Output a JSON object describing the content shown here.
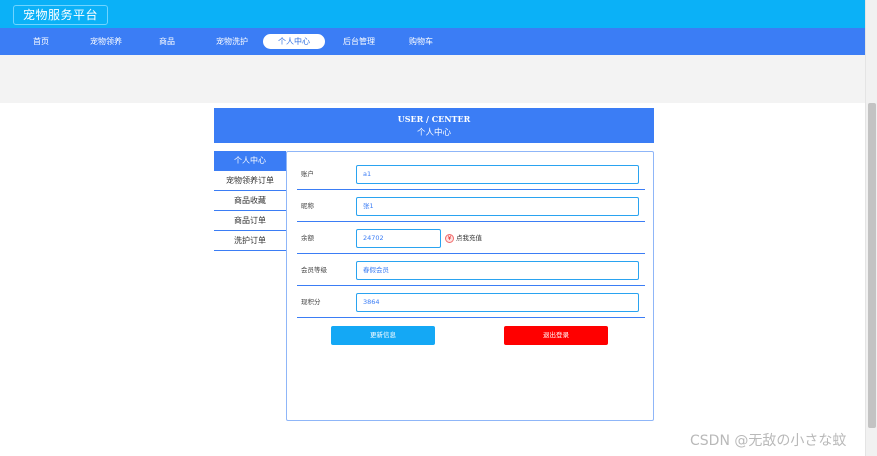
{
  "brand": "宠物服务平台",
  "nav": {
    "items": [
      "首页",
      "宠物领养",
      "商品",
      "宠物洗护",
      "个人中心",
      "后台管理",
      "购物车"
    ],
    "active": "个人中心"
  },
  "center": {
    "title_en": "USER / CENTER",
    "title_cn": "个人中心"
  },
  "menu": {
    "items": [
      "个人中心",
      "宠物领养订单",
      "商品收藏",
      "商品订单",
      "洗护订单"
    ]
  },
  "form": {
    "account_label": "账户",
    "account_value": "a1",
    "nickname_label": "昵称",
    "nickname_value": "张1",
    "balance_label": "余额",
    "balance_value": "24702",
    "recharge_label": "点我充值",
    "level_label": "会员等级",
    "level_value": "春假会员",
    "points_label": "现积分",
    "points_value": "3864"
  },
  "buttons": {
    "update": "更新信息",
    "logout": "退出登录"
  },
  "watermark": "CSDN @无敌の小さな蚊",
  "colors": {
    "topbar": "#0bb1f7",
    "navbar": "#3b7df5",
    "danger": "#ff0000",
    "primary": "#14a8f5"
  }
}
